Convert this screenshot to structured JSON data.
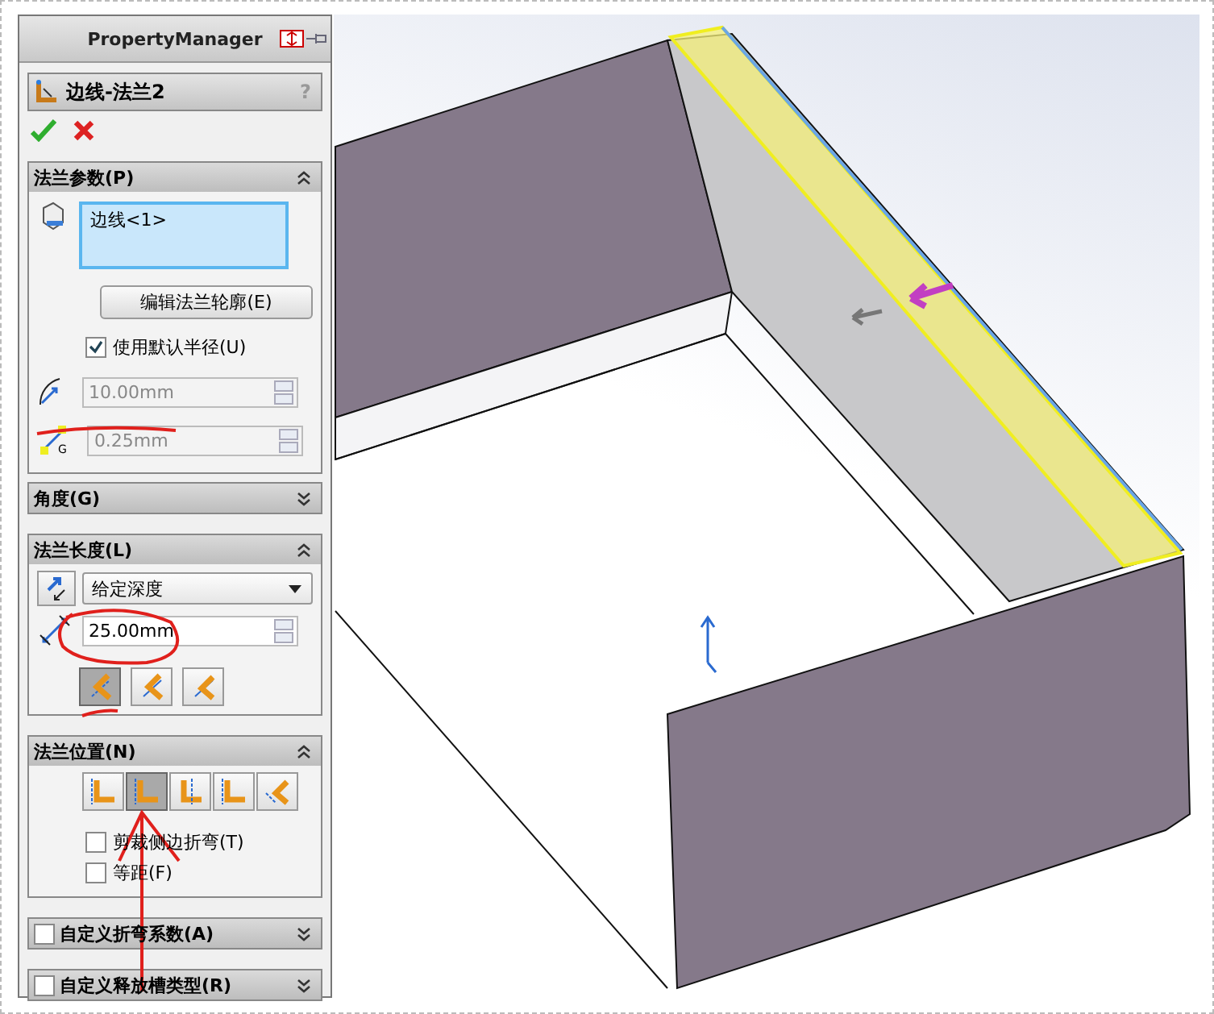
{
  "panel": {
    "title": "PropertyManager"
  },
  "feature": {
    "name": "边线-法兰2",
    "help": "?"
  },
  "flange_params": {
    "title": "法兰参数(P)",
    "expanded": true,
    "selection": "边线<1>",
    "edit_button": "编辑法兰轮廓(E)",
    "default_radius": {
      "label": "使用默认半径(U)",
      "checked": true
    },
    "radius": {
      "value": "10.00mm",
      "disabled": true
    },
    "gap": {
      "icon_label": "G",
      "value": "0.25mm",
      "disabled": true
    }
  },
  "angle": {
    "title": "角度(G)",
    "expanded": false
  },
  "flange_length": {
    "title": "法兰长度(L)",
    "expanded": true,
    "end_condition": "给定深度",
    "length": {
      "value": "25.00mm",
      "disabled": false
    },
    "options": [
      {
        "selected": true
      },
      {
        "selected": false
      },
      {
        "selected": false
      }
    ]
  },
  "flange_position": {
    "title": "法兰位置(N)",
    "expanded": true,
    "options": [
      {
        "selected": false
      },
      {
        "selected": true
      },
      {
        "selected": false
      },
      {
        "selected": false
      },
      {
        "selected": false
      }
    ],
    "checkboxes": [
      {
        "label": "剪裁侧边折弯(T)",
        "checked": false
      },
      {
        "label": "等距(F)",
        "checked": false
      }
    ]
  },
  "custom_sections": [
    {
      "title": "自定义折弯系数(A)",
      "checked": false,
      "expanded": false
    },
    {
      "title": "自定义释放槽类型(R)",
      "checked": false,
      "expanded": false
    }
  ]
}
